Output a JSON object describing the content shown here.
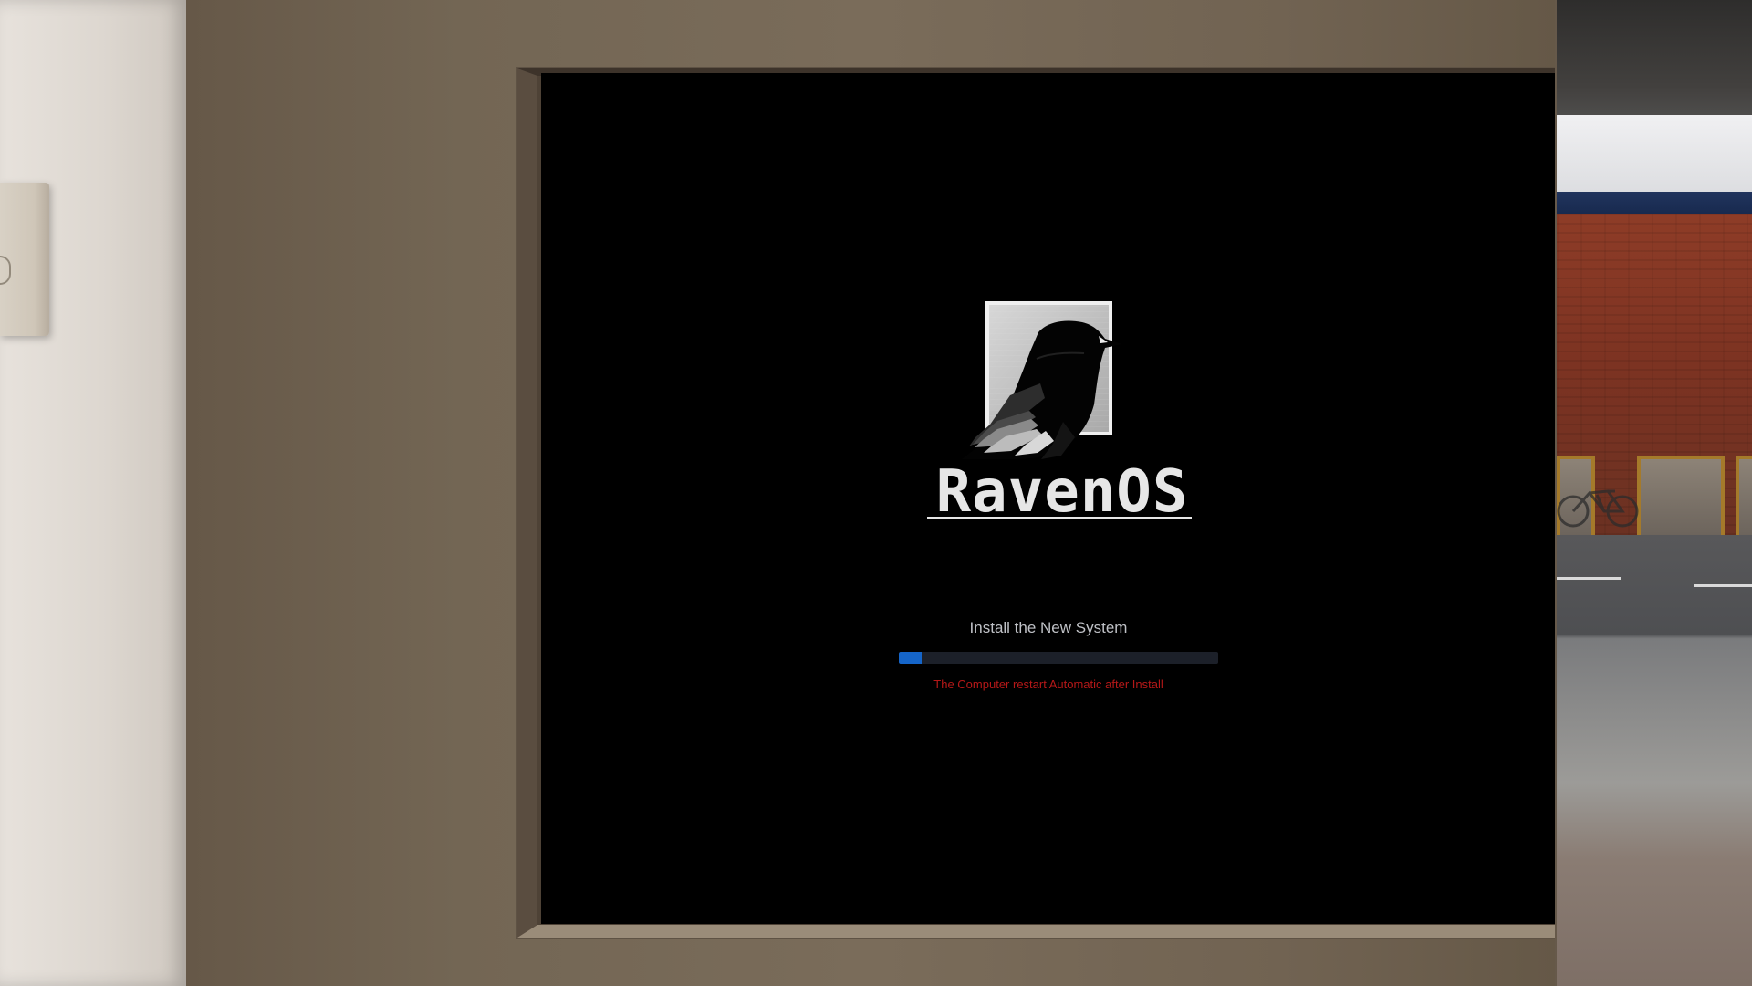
{
  "screen": {
    "brand_name": "RavenOS",
    "install_title": "Install the New System",
    "restart_note": "The Computer restart Automatic after Install",
    "progress_percent": 7
  },
  "colors": {
    "screen_bg": "#000000",
    "brand_text": "#e6e6e6",
    "status_text": "#bfc1c6",
    "progress_track": "#1c2029",
    "progress_fill": "#1565c9",
    "note_red": "#b51818",
    "bezel_brown": "#736654"
  },
  "icons": {
    "logo": "raven-logo-icon"
  }
}
